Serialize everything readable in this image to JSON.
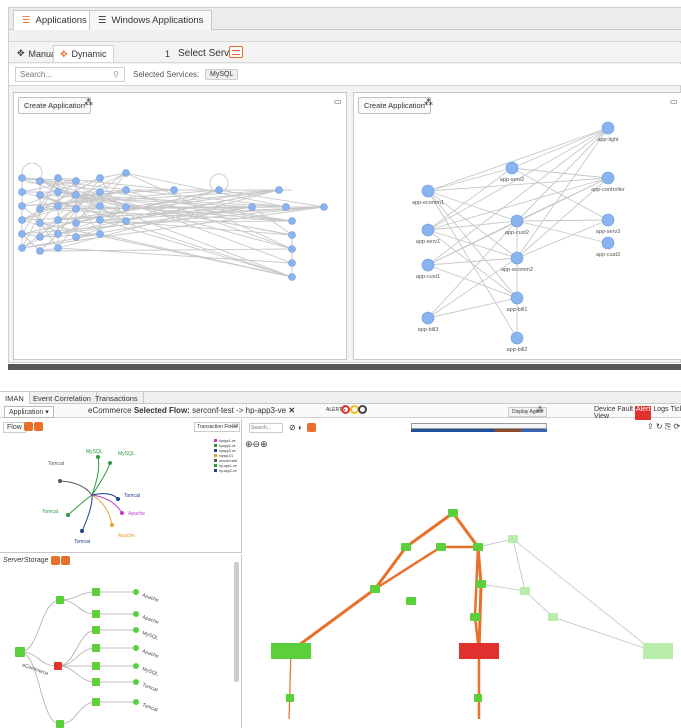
{
  "top_panel": {
    "tabs": [
      {
        "label": "Applications",
        "active": true,
        "icon": "stack-icon"
      },
      {
        "label": "Windows Applications",
        "active": false,
        "icon": "stack-icon"
      }
    ],
    "modes": [
      {
        "label": "Manual",
        "active": false,
        "icon": "manual-icon"
      },
      {
        "label": "Dynamic",
        "active": true,
        "icon": "dynamic-icon"
      }
    ],
    "step": {
      "number": "1",
      "label": "Select Service"
    },
    "search_placeholder": "Search...",
    "selected_services_label": "Selected Services:",
    "selected_service_tag": "MySQL",
    "left_pane": {
      "create_label": "Create Application"
    },
    "right_pane": {
      "create_label": "Create Application",
      "nodes": [
        "app-ecomm1",
        "app-serv2",
        "app-serv1",
        "app-cust2",
        "app-cust1",
        "app-ecomm2",
        "app-bill1",
        "app-bill3",
        "app-bill2",
        "app-controller",
        "app-serv3",
        "app-cust3",
        "app-light"
      ]
    }
  },
  "bottom_panel": {
    "tabs": [
      {
        "label": "IMAN",
        "active": true
      },
      {
        "label": "Event Correlation",
        "active": false
      },
      {
        "label": "Transactions",
        "active": false
      }
    ],
    "application_dropdown": "Application ▾",
    "flow_title_prefix": "eCommerce",
    "flow_title_bold": "Selected Flow:",
    "flow_title_value": "serconf-test -> hp-app3-ve",
    "alerts_label": "ALERTS",
    "display_agent_label": "Display Agent",
    "right_buttons": [
      "Device View",
      "Fault",
      "Alert",
      "Logs",
      "Ticket"
    ],
    "active_right_button": "Alert",
    "flow_label": "Flow",
    "transaction_flows_label": "Transaction Flows",
    "server_tab": "Server",
    "storage_tab": "Storage",
    "search_placeholder": "Search...",
    "flow_nodes": [
      "Tomcat",
      "MySQL",
      "MySQL",
      "Tomcat",
      "Apache",
      "Apache",
      "Tomcat",
      "Tomcat"
    ],
    "legend_entries": [
      "hpapp1-ve",
      "hpapp2-ve",
      "hpapp3-ve",
      "mysql-01",
      "serconf-test",
      "hp-app1-ve",
      "hp-app2-ve"
    ],
    "tree_root": "eCommerce",
    "tree_items": [
      "Apache",
      "Apache",
      "MySQL",
      "Apache",
      "MySQL",
      "Tomcat",
      "Tomcat"
    ],
    "colors": {
      "accent": "#e8702a",
      "blue_bar": "#1f4e9c",
      "red_alert": "#e0312e",
      "green": "#5bd03a"
    }
  }
}
